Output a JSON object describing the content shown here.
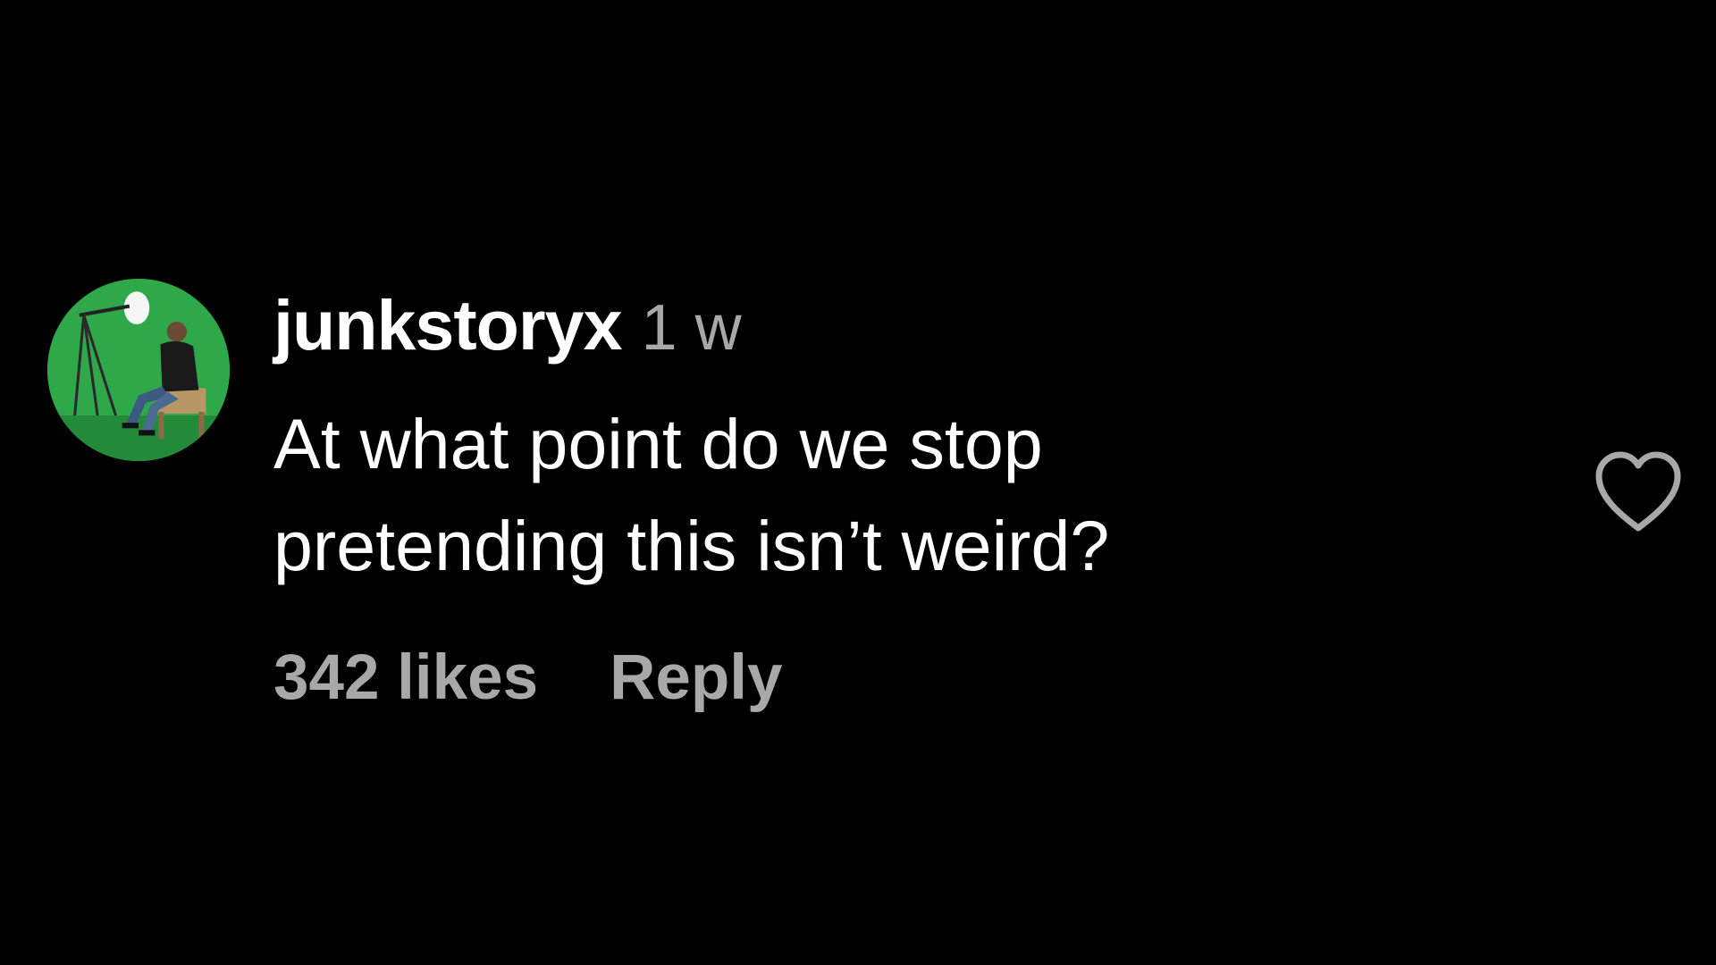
{
  "comment": {
    "username": "junkstoryx",
    "timestamp": "1 w",
    "text_lines": [
      "At what point do we stop",
      "pretending this isn’t weird?"
    ],
    "likes": "342 likes",
    "reply_label": "Reply",
    "like_icon": "heart-outline-icon"
  },
  "colors": {
    "background": "#000000",
    "primary_text": "#ffffff",
    "secondary_text": "#a8a8a8",
    "avatar_background": "#2fa84a"
  }
}
